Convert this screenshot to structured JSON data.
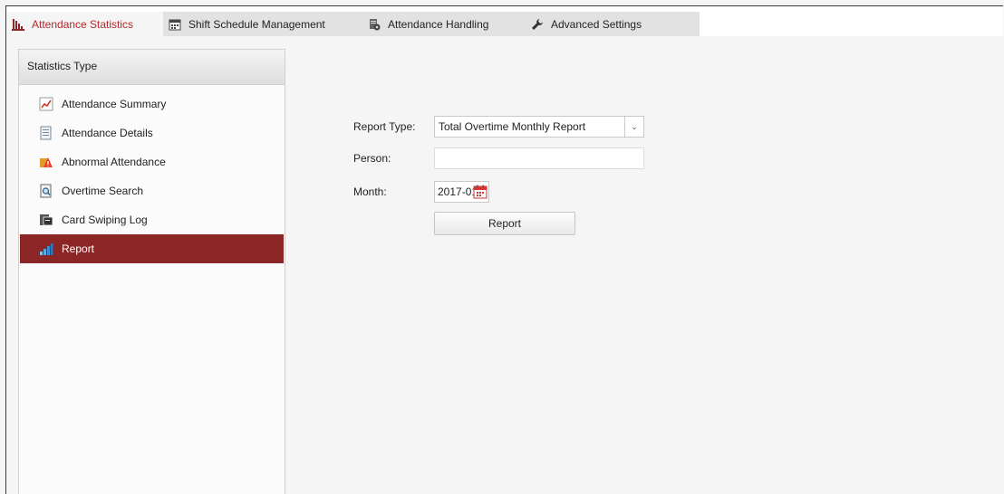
{
  "tabs": [
    {
      "label": "Attendance Statistics",
      "icon": "bar-chart-icon",
      "active": true
    },
    {
      "label": "Shift Schedule Management",
      "icon": "calendar-icon",
      "active": false
    },
    {
      "label": "Attendance Handling",
      "icon": "handling-icon",
      "active": false
    },
    {
      "label": "Advanced Settings",
      "icon": "wrench-icon",
      "active": false
    }
  ],
  "sidebar": {
    "title": "Statistics Type",
    "items": [
      {
        "label": "Attendance Summary",
        "icon": "summary-chart-icon"
      },
      {
        "label": "Attendance Details",
        "icon": "details-document-icon"
      },
      {
        "label": "Abnormal Attendance",
        "icon": "warning-icon"
      },
      {
        "label": "Overtime Search",
        "icon": "search-document-icon"
      },
      {
        "label": "Card Swiping Log",
        "icon": "card-log-icon"
      },
      {
        "label": "Report",
        "icon": "report-bars-icon",
        "active": true
      }
    ]
  },
  "form": {
    "report_type_label": "Report Type:",
    "report_type_value": "Total Overtime Monthly Report",
    "person_label": "Person:",
    "person_value": "",
    "month_label": "Month:",
    "month_value": "2017-01",
    "report_button": "Report"
  },
  "colors": {
    "accent": "#b3292b",
    "active_item_bg": "#8b2526"
  }
}
